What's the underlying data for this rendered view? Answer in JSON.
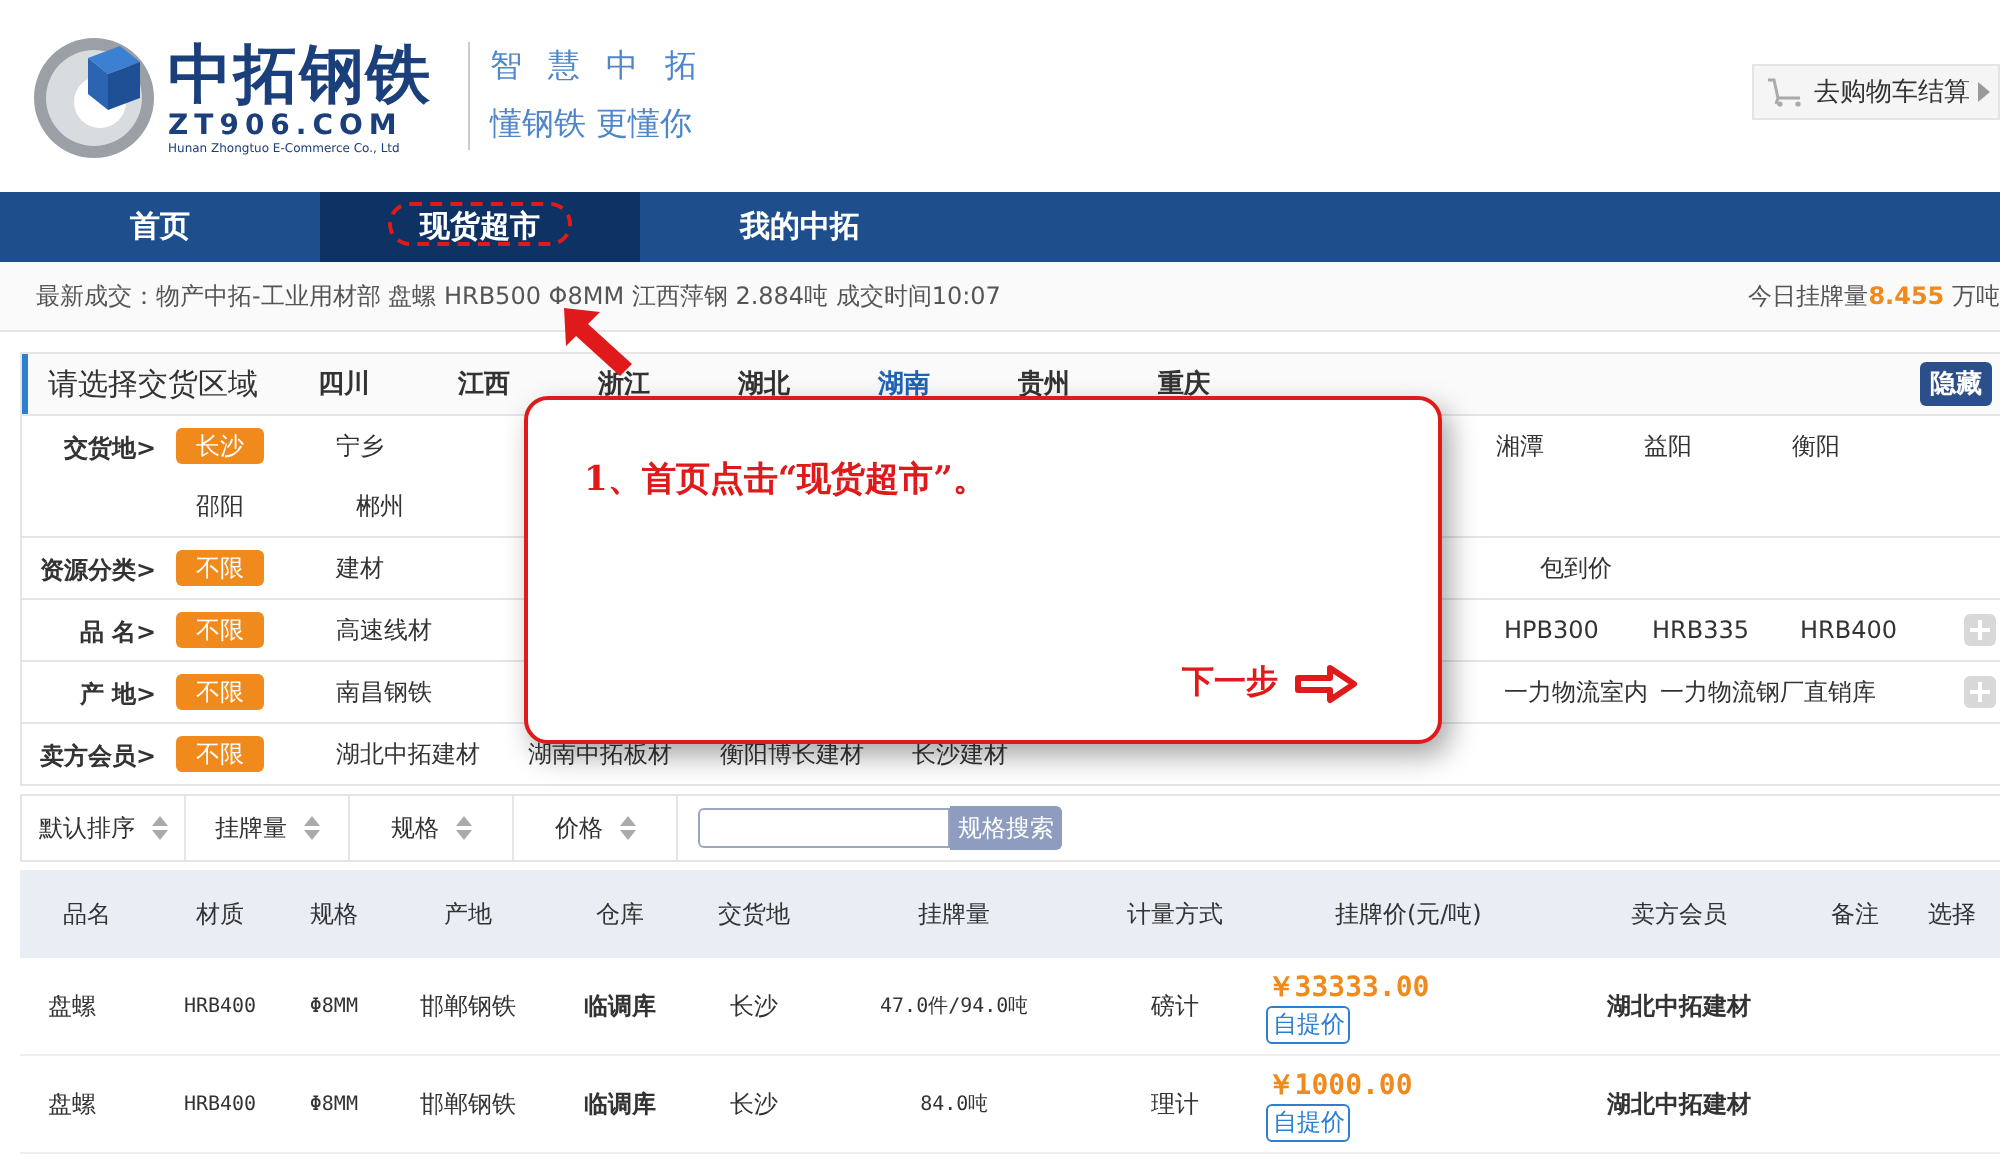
{
  "header": {
    "brand": "中拓钢铁",
    "domain": "ZT906.COM",
    "company": "Hunan Zhongtuo E-Commerce Co., Ltd",
    "slogan_1": "智 慧 中 拓",
    "slogan_2": "懂钢铁 更懂你",
    "cart_button": "去购物车结算"
  },
  "nav": [
    {
      "label": "首页",
      "selected": false
    },
    {
      "label": "现货超市",
      "selected": true
    },
    {
      "label": "我的中拓",
      "selected": false
    }
  ],
  "ticker": {
    "text": "最新成交：物产中拓-工业用材部 盘螺 HRB500 Φ8MM 江西萍钢 2.884吨 成交时间10:07",
    "today_label": "今日挂牌量",
    "today_value": "8.455",
    "today_unit": "万吨"
  },
  "region_panel": {
    "title": "请选择交货区域",
    "hide_button": "隐藏",
    "regions": [
      {
        "label": "四川",
        "selected": false
      },
      {
        "label": "江西",
        "selected": false
      },
      {
        "label": "浙江",
        "selected": false
      },
      {
        "label": "湖北",
        "selected": false
      },
      {
        "label": "湖南",
        "selected": true
      },
      {
        "label": "贵州",
        "selected": false
      },
      {
        "label": "重庆",
        "selected": false
      }
    ],
    "filters": [
      {
        "label": "交货地>",
        "chip": {
          "text": "长沙",
          "selected": true
        },
        "left": [
          "宁乡"
        ],
        "right": [
          "湘潭",
          "益阳",
          "衡阳"
        ],
        "wrapped": [
          "邵阳",
          "郴州"
        ],
        "more": false
      },
      {
        "label": "资源分类>",
        "chip": {
          "text": "不限",
          "selected": true
        },
        "left": [
          "建材"
        ],
        "right": [
          "包到价"
        ],
        "more": false
      },
      {
        "label": "品 名>",
        "chip": {
          "text": "不限",
          "selected": true
        },
        "left": [
          "高速线材"
        ],
        "right": [
          "HPB300",
          "HRB335",
          "HRB400"
        ],
        "more": true
      },
      {
        "label": "产 地>",
        "chip": {
          "text": "不限",
          "selected": true
        },
        "left": [
          "南昌钢铁"
        ],
        "right": [
          "一力物流室内",
          "一力物流钢厂直销库"
        ],
        "more": true
      },
      {
        "label": "卖方会员>",
        "chip": {
          "text": "不限",
          "selected": true
        },
        "left": [
          "湖北中拓建材",
          "湖南中拓板材",
          "衡阳博长建材",
          "长沙建材"
        ],
        "more": false
      }
    ]
  },
  "sort_bar": {
    "sorts": [
      "默认排序",
      "挂牌量",
      "规格",
      "价格"
    ],
    "search_button": "规格搜索"
  },
  "table": {
    "columns": [
      "品名",
      "材质",
      "规格",
      "产地",
      "仓库",
      "交货地",
      "挂牌量",
      "计量方式",
      "挂牌价(元/吨)",
      "卖方会员",
      "备注",
      "选择"
    ],
    "rows": [
      {
        "name": "盘螺",
        "material": "HRB400",
        "spec": "Φ8MM",
        "origin": "邯郸钢铁",
        "warehouse": "临调库",
        "delivery": "长沙",
        "quantity": "47.0件/94.0吨",
        "measure": "磅计",
        "price": "￥33333.00",
        "price_tag": "自提价",
        "seller": "湖北中拓建材"
      },
      {
        "name": "盘螺",
        "material": "HRB400",
        "spec": "Φ8MM",
        "origin": "邯郸钢铁",
        "warehouse": "临调库",
        "delivery": "长沙",
        "quantity": "84.0吨",
        "measure": "理计",
        "price": "￥1000.00",
        "price_tag": "自提价",
        "seller": "湖北中拓建材"
      }
    ]
  },
  "guide": {
    "message": "1、首页点击“现货超市”。",
    "next": "下一步"
  }
}
